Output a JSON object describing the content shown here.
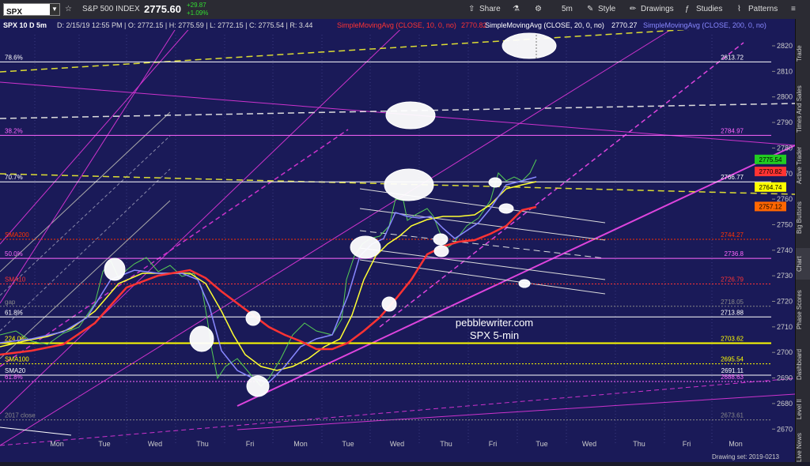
{
  "toolbar": {
    "symbol": "SPX",
    "index_name": "S&P 500 INDEX",
    "price": "2775.60",
    "change": "+29.87",
    "change_pct": "+1.09%",
    "share": "Share",
    "timeframe": "5m",
    "style": "Style",
    "drawings": "Drawings",
    "studies": "Studies",
    "patterns": "Patterns"
  },
  "chart": {
    "header": "SPX 10 D 5m",
    "info": "D: 2/15/19 12:55 PM | O: 2772.15 | H: 2775.59 | L: 2772.15 | C: 2775.54 | R: 3.44",
    "sma10_label": "SimpleMovingAvg (CLOSE, 10, 0, no)",
    "sma10_value": "2770.82",
    "sma20_label": "SimpleMovingAvg (CLOSE, 20, 0, no)",
    "sma20_value": "2770.27",
    "sma200_label": "SimpleMovingAvg (CLOSE, 200, 0, no)",
    "watermark1": "pebblewriter.com",
    "watermark2": "SPX 5-min",
    "days": [
      "Mon",
      "Tue",
      "Wed",
      "Thu",
      "Fri",
      "Mon",
      "Tue",
      "Wed",
      "Thu",
      "Fri",
      "Tue",
      "Wed",
      "Thu",
      "Fri",
      "Mon"
    ],
    "price_ticks": [
      "2820",
      "2810",
      "2800",
      "2790",
      "2780",
      "2770",
      "2760",
      "2750",
      "2740",
      "2730",
      "2720",
      "2710",
      "2700",
      "2690",
      "2680",
      "2670"
    ],
    "levels": [
      {
        "name": "78.6%",
        "value": "2813.72",
        "color": "#ffffff"
      },
      {
        "name": "38.2%",
        "value": "2784.97",
        "color": "#ff66ff"
      },
      {
        "name": "70.7%",
        "value": "2766.77",
        "color": "#ffffff"
      },
      {
        "name": "SMA200",
        "value": "2744.27",
        "color": "#ff3300"
      },
      {
        "name": "50.0%",
        "value": "2736.8",
        "color": "#ff66ff"
      },
      {
        "name": "SMA10",
        "value": "2726.79",
        "color": "#ff3333"
      },
      {
        "name": "gap",
        "value": "2718.05",
        "color": "#888888"
      },
      {
        "name": "61.8%",
        "value": "2713.88",
        "color": "#ffffff"
      },
      {
        "name": "224.0%",
        "value": "2703.62",
        "color": "#ffff00"
      },
      {
        "name": "SMA100",
        "value": "2695.54",
        "color": "#ffff00"
      },
      {
        "name": "SMA20",
        "value": "2691.11",
        "color": "#ffffff"
      },
      {
        "name": "61.8%",
        "value": "2688.63",
        "color": "#ff66ff"
      },
      {
        "name": "2017 close",
        "value": "2673.61",
        "color": "#888888"
      }
    ],
    "price_tags": [
      {
        "value": "2775.54",
        "color": "#22cc22"
      },
      {
        "value": "2770.82",
        "color": "#ff3333"
      },
      {
        "value": "2764.74",
        "color": "#ffff00"
      },
      {
        "value": "2757.12",
        "color": "#ff6600"
      }
    ]
  },
  "sidebar": [
    "Trade",
    "Times And Sales",
    "Active Trader",
    "Big Buttons",
    "Chart",
    "Phase Scores",
    "Dashboard",
    "Level II",
    "Live News"
  ],
  "bottom": {
    "drawing_set": "Drawing set: 2019-0213"
  }
}
